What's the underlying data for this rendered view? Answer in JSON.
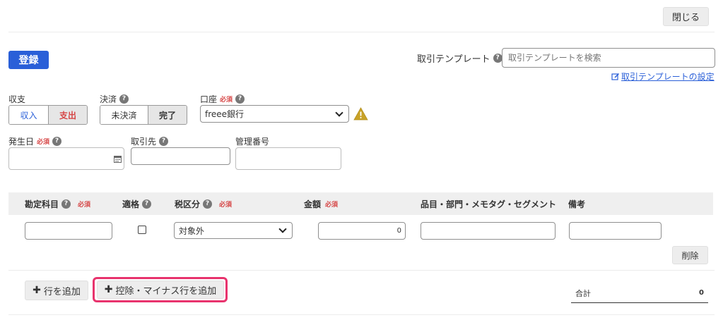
{
  "header": {
    "close_label": "閉じる"
  },
  "toolbar": {
    "register_label": "登録",
    "template_label": "取引テンプレート",
    "template_placeholder": "取引テンプレートを検索",
    "template_settings_link": "取引テンプレートの設定"
  },
  "form": {
    "income_expense": {
      "label": "収支",
      "options": [
        "収入",
        "支出"
      ],
      "selected": "支出"
    },
    "settlement": {
      "label": "決済",
      "options": [
        "未決済",
        "完了"
      ],
      "selected": "完了"
    },
    "account": {
      "label": "口座",
      "required": "必須",
      "value": "freee銀行"
    },
    "date": {
      "label": "発生日",
      "required": "必須",
      "value": ""
    },
    "partner": {
      "label": "取引先",
      "value": ""
    },
    "management_number": {
      "label": "管理番号",
      "value": ""
    }
  },
  "table": {
    "headers": {
      "account_item": "勘定科目",
      "account_item_required": "必須",
      "qualified": "適格",
      "tax_category": "税区分",
      "tax_category_required": "必須",
      "amount": "金額",
      "amount_required": "必須",
      "tags": "品目・部門・メモタグ・セグメント",
      "remarks": "備考"
    },
    "rows": [
      {
        "account_item": "",
        "qualified": false,
        "tax_category": "対象外",
        "amount": "0",
        "tags": "",
        "remarks": ""
      }
    ],
    "delete_label": "削除"
  },
  "footer": {
    "add_row_label": "行を追加",
    "add_deduction_row_label": "控除・マイナス行を追加",
    "total_label": "合計",
    "total_value": "0"
  },
  "colors": {
    "primary": "#2a5fd8",
    "required": "#d64545",
    "highlight": "#e8336d",
    "warning": "#d4a017"
  }
}
